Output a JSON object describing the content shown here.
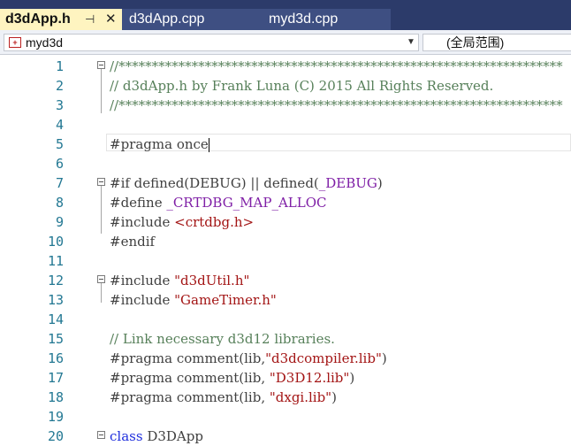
{
  "tabs": [
    {
      "label": "d3dApp.h",
      "active": true,
      "pin": "⊣",
      "close": "✕"
    },
    {
      "label": "d3dApp.cpp",
      "active": false
    },
    {
      "label": "myd3d.cpp",
      "active": false
    }
  ],
  "nav": {
    "project": "myd3d",
    "scope": "(全局范围)"
  },
  "icons": {
    "project_icon": "project-icon",
    "dropdown": "chevron-down-icon"
  },
  "lines": [
    {
      "n": "1"
    },
    {
      "n": "2"
    },
    {
      "n": "3"
    },
    {
      "n": "4"
    },
    {
      "n": "5"
    },
    {
      "n": "6"
    },
    {
      "n": "7"
    },
    {
      "n": "8"
    },
    {
      "n": "9"
    },
    {
      "n": "10"
    },
    {
      "n": "11"
    },
    {
      "n": "12"
    },
    {
      "n": "13"
    },
    {
      "n": "14"
    },
    {
      "n": "15"
    },
    {
      "n": "16"
    },
    {
      "n": "17"
    },
    {
      "n": "18"
    },
    {
      "n": "19"
    },
    {
      "n": "20"
    }
  ],
  "code": {
    "l1": "//*******************************************************************",
    "l2": "// d3dApp.h by Frank Luna (C) 2015 All Rights Reserved.",
    "l3": "//*******************************************************************",
    "l5": "#pragma once",
    "l7_a": "#if defined(",
    "l7_b": "DEBUG",
    "l7_c": ") || defined(",
    "l7_d": "_DEBUG",
    "l7_e": ")",
    "l8_a": "#define ",
    "l8_b": "_CRTDBG_MAP_ALLOC",
    "l9_a": "#include ",
    "l9_b": "<crtdbg.h>",
    "l10": "#endif",
    "l12_a": "#include ",
    "l12_b": "\"d3dUtil.h\"",
    "l13_a": "#include ",
    "l13_b": "\"GameTimer.h\"",
    "l15": "// Link necessary d3d12 libraries.",
    "l16_a": "#pragma comment(lib,",
    "l16_b": "\"d3dcompiler.lib\"",
    "l16_c": ")",
    "l17_a": "#pragma comment(lib, ",
    "l17_b": "\"D3D12.lib\"",
    "l17_c": ")",
    "l18_a": "#pragma comment(lib, ",
    "l18_b": "\"dxgi.lib\"",
    "l18_c": ")",
    "l20_a": "class",
    "l20_b": " D3DApp"
  },
  "colors": {
    "tabbar": "#2c3b6a",
    "active_tab": "#fef4c0",
    "line_number": "#237893",
    "comment": "#57805a",
    "string": "#a31515",
    "macro": "#7f1fa6",
    "keyword": "#1f2fdd"
  }
}
